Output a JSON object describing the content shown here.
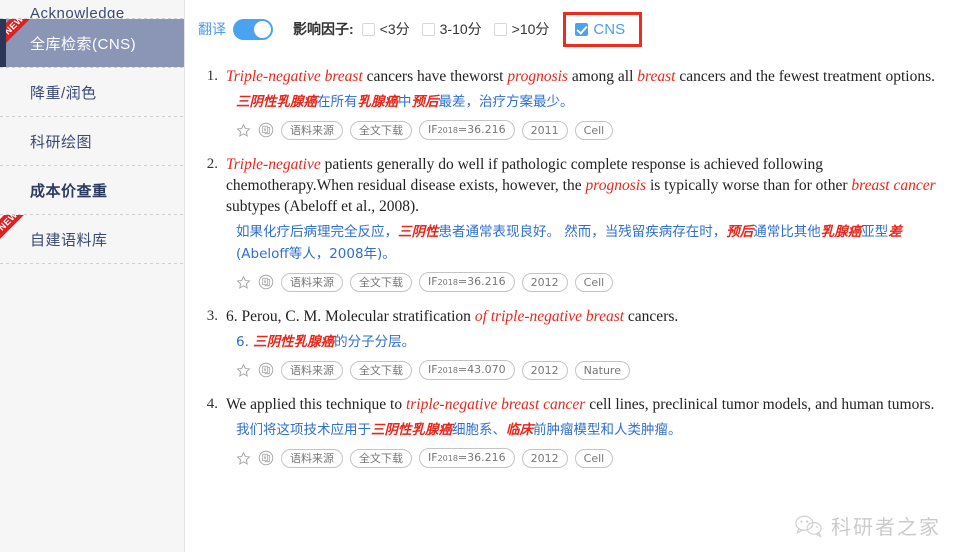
{
  "sidebar": {
    "items": [
      {
        "label": "Acknowledge",
        "badge": "",
        "state": "partial"
      },
      {
        "label": "全库检索(CNS)",
        "badge": "NEW",
        "state": "active"
      },
      {
        "label": "降重/润色",
        "badge": "",
        "state": "normal"
      },
      {
        "label": "科研绘图",
        "badge": "",
        "state": "normal"
      },
      {
        "label": "成本价查重",
        "badge": "",
        "state": "bold"
      },
      {
        "label": "自建语料库",
        "badge": "NEW",
        "state": "normal"
      }
    ]
  },
  "toolbar": {
    "translate_label": "翻译",
    "translate_on": true,
    "impact_factor_label": "影响因子:",
    "filters": [
      {
        "label": "<3分",
        "checked": false
      },
      {
        "label": "3-10分",
        "checked": false
      },
      {
        "label": ">10分",
        "checked": false
      },
      {
        "label": "CNS",
        "checked": true,
        "highlighted": true
      }
    ],
    "highlight_color": "#f02b1d",
    "accent_color": "#4aa3f0"
  },
  "results": [
    {
      "num": "1.",
      "en_html": "<i>Triple-negative breast</i> cancers have theworst <i>prognosis</i> among all <i>breast</i> cancers and the fewest treatment options.",
      "zh_html": "<i>三阴性乳腺癌</i>在所有<i>乳腺癌</i>中<i>预后</i>最差，治疗方案最少。",
      "tags": {
        "source": "语料来源",
        "download": "全文下载",
        "if_prefix": "IF",
        "if_year": "2018",
        "if_value": "=36.216",
        "year": "2011",
        "journal": "Cell"
      }
    },
    {
      "num": "2.",
      "en_html": "<i>Triple-negative</i> patients generally do well if pathologic complete response is achieved following chemotherapy.When residual disease exists, however, the <i>prognosis</i> is typically worse than for other <i>breast cancer</i> subtypes (Abeloff et al., 2008).",
      "zh_html": "如果化疗后病理完全反应，<i>三阴性</i>患者通常表现良好。 然而，当残留疾病存在时，<i>预后</i>通常比其他<i>乳腺癌</i>亚型<i>差</i>(Abeloff等人，2008年)。",
      "tags": {
        "source": "语料来源",
        "download": "全文下载",
        "if_prefix": "IF",
        "if_year": "2018",
        "if_value": "=36.216",
        "year": "2012",
        "journal": "Cell"
      }
    },
    {
      "num": "3.",
      "en_html": "6. Perou, C. M. Molecular stratification <i>of triple-negative breast</i> cancers.",
      "zh_html": "6. <i>三阴性乳腺癌</i>的分子分层。",
      "tags": {
        "source": "语料来源",
        "download": "全文下载",
        "if_prefix": "IF",
        "if_year": "2018",
        "if_value": "=43.070",
        "year": "2012",
        "journal": "Nature"
      }
    },
    {
      "num": "4.",
      "en_html": "We applied this technique to <i>triple-negative breast cancer</i> cell lines, preclinical tumor models, and human tumors.",
      "zh_html": "我们将这项技术应用于<i>三阴性乳腺癌</i>细胞系、<i>临床</i>前肿瘤模型和人类肿瘤。",
      "tags": {
        "source": "语料来源",
        "download": "全文下载",
        "if_prefix": "IF",
        "if_year": "2018",
        "if_value": "=36.216",
        "year": "2012",
        "journal": "Cell"
      }
    }
  ],
  "watermark": {
    "text": "科研者之家",
    "icon": "wechat-icon"
  }
}
